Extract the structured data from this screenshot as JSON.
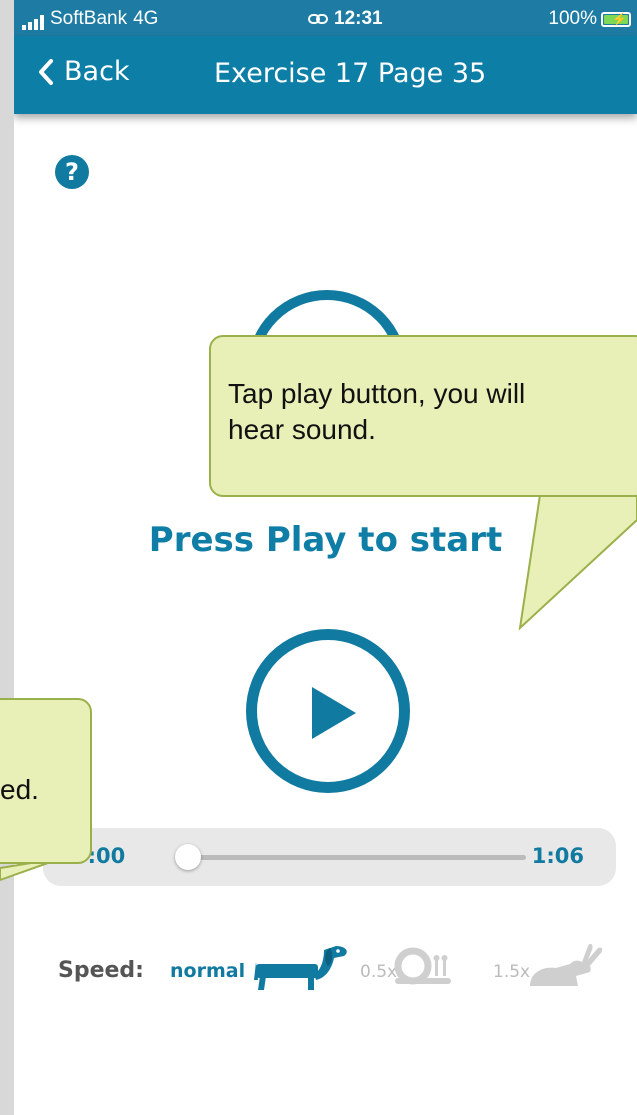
{
  "status_bar": {
    "carrier": "SoftBank",
    "network": "4G",
    "time": "12:31",
    "battery": "100%"
  },
  "nav": {
    "back_label": "Back",
    "title": "Exercise 17 Page 35"
  },
  "help_glyph": "?",
  "prompt": "Press Play to start",
  "player": {
    "current_time": "0:00",
    "total_time": "1:06",
    "progress": 0
  },
  "speed": {
    "label": "Speed:",
    "options": [
      "normal",
      "0.5x",
      "1.5x"
    ],
    "selected": "normal"
  },
  "callouts": {
    "play_hint_line1": "Tap play button, you will",
    "play_hint_line2": "hear sound.",
    "speed_hint_partial": "ed."
  },
  "colors": {
    "accent": "#117aa0",
    "nav_background": "#0d7ea6",
    "callout_fill": "#e8f0b8",
    "callout_border": "#9ab04a"
  }
}
